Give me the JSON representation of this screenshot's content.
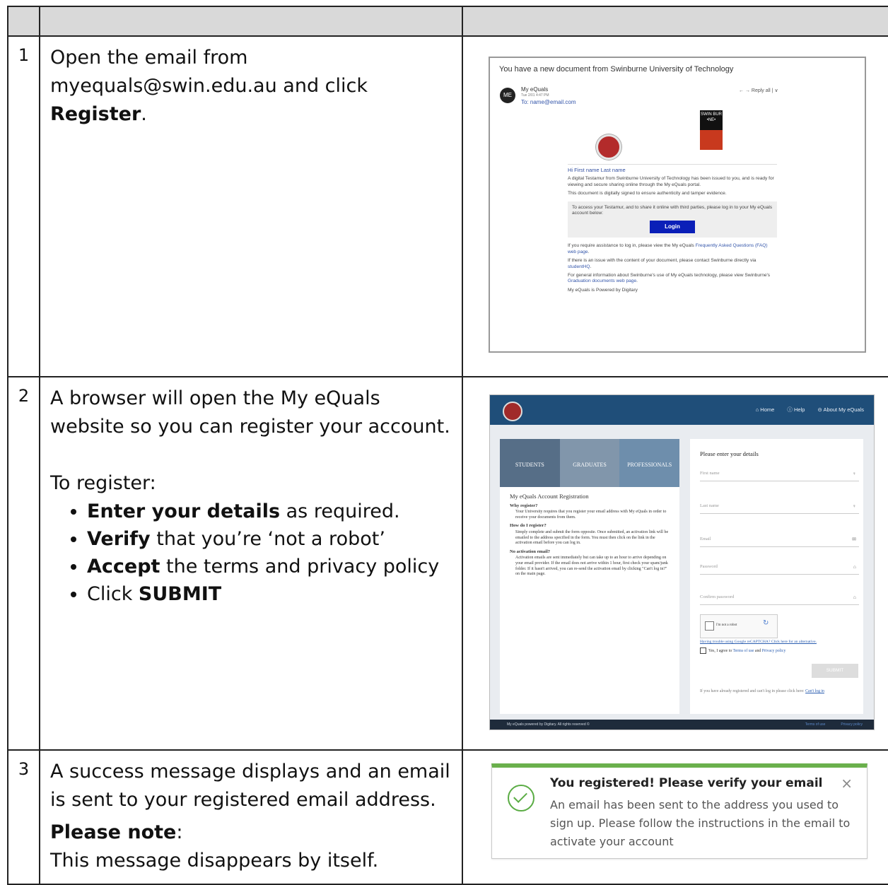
{
  "rows": [
    {
      "num": "1",
      "line1": "Open the email from",
      "line2": "myequals@swin.edu.au and click",
      "bold": "Register",
      "after": "."
    },
    {
      "num": "2",
      "intro1": "A browser will open the My eQuals",
      "intro2": "website so you can register your account.",
      "to_register": "To register:",
      "bullets": [
        {
          "bold": "Enter your details",
          "rest": " as required."
        },
        {
          "bold": "Verify",
          "rest": " that you’re ‘not a robot’"
        },
        {
          "bold": "Accept",
          "rest": " the terms and privacy policy"
        },
        {
          "pre": "Click ",
          "bold": "SUBMIT"
        }
      ]
    },
    {
      "num": "3",
      "line1": "A success message displays and an email",
      "line2": "is sent to your registered email address.",
      "note_label": "Please note",
      "note_colon": ":",
      "note_text": "This message disappears by itself."
    }
  ],
  "email": {
    "subject": "You have a new document from Swinburne University of Technology",
    "avatar": "ME",
    "from": "My eQuals",
    "date": "Tue 2/01 4:47 PM",
    "to": "To: name@email.com",
    "actions": "←   →   Reply all  |  ∨",
    "logo_text": "SWIN BUR •NE•",
    "greeting": "Hi First name Last name",
    "p1": "A digital Testamur from Swinburne University of Technology has been issued to you, and is ready for viewing and secure sharing online through the My eQuals portal.",
    "p2": "This document is digitally signed to ensure authenticity and tamper evidence.",
    "box_text": "To access your Testamur, and to share it online with third parties, please log in to your My eQuals account below:",
    "login": "Login",
    "p3a": "If you require assistance to log in, please view the My eQuals ",
    "p3link": "Frequently Asked Questions (FAQ) web page",
    "p3b": ".",
    "p4a": "If there is an issue with the content of your document, please contact Swinburne directly via ",
    "p4link": "studentHQ",
    "p4b": ".",
    "p5a": "For general information about Swinburne's use of My eQuals technology, please view Swinburne's ",
    "p5link": "Graduation documents web page",
    "p5b": ".",
    "p6": "My eQuals is Powered by Digitary"
  },
  "site": {
    "nav": {
      "home": "⌂ Home",
      "help": "ⓘ Help",
      "about": "⊝ About My eQuals"
    },
    "banner": [
      "STUDENTS",
      "GRADUATES",
      "PROFESSIONALS"
    ],
    "heading": "My eQuals Account Registration",
    "q1": "Why register?",
    "a1": "Your University requires that you register your email address with My eQuals in order to receive your documents from them.",
    "q2": "How do I register?",
    "a2": "Simply complete and submit the form opposite. Once submitted, an activation link will be emailed to the address specified in the form. You must then click on the link in the activation email before you can log in.",
    "q3": "No activation email?",
    "a3": "Activation emails are sent immediately but can take up to an hour to arrive depending on your email provider. If the email does not arrive within 1 hour, first check your spam/junk folder. If it hasn't arrived, you can re-send the activation email by clicking \"Can't log in?\" on the main page.",
    "form_title": "Please enter your details",
    "fields": [
      {
        "label": "First name",
        "icon": "♀"
      },
      {
        "label": "Last name",
        "icon": "♀"
      },
      {
        "label": "Email",
        "icon": "✉"
      },
      {
        "label": "Password",
        "icon": "⌂"
      },
      {
        "label": "Confirm password",
        "icon": "⌂"
      }
    ],
    "captcha": "I'm not a robot",
    "captcha_sub": "reCAPTCHA",
    "captcha_help": "Having trouble using Google reCAPTCHA? Click here for an alternative.",
    "agree_pre": "Yes, I agree to ",
    "terms": "Terms of use",
    "agree_and": " and ",
    "privacy": "Privacy policy",
    "submit": "SUBMIT",
    "already": "If you have already registered and can't log in please click here: ",
    "cant": "Can't log in",
    "footer_left": "My eQuals powered by Digitary. All rights reserved ©",
    "footer_terms": "Terms of use",
    "footer_privacy": "Privacy policy"
  },
  "toast": {
    "title": "You registered! Please verify your email",
    "close": "×",
    "message": "An email has been sent to the address you used to sign up. Please follow the instructions in the email to activate your account"
  }
}
